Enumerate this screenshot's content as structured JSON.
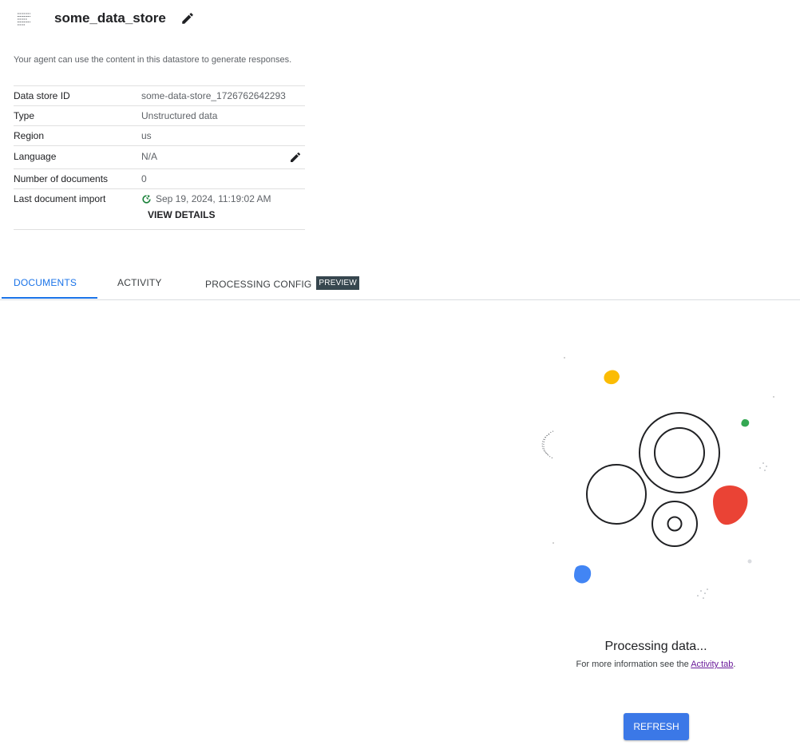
{
  "header": {
    "title": "some_data_store",
    "icon": "data-store-icon",
    "edit_icon": "edit-pencil-icon"
  },
  "description": "Your agent can use the content in this datastore to generate responses.",
  "info": {
    "rows": [
      {
        "label": "Data store ID",
        "value": "some-data-store_1726762642293"
      },
      {
        "label": "Type",
        "value": "Unstructured data"
      },
      {
        "label": "Region",
        "value": "us"
      },
      {
        "label": "Language",
        "value": "N/A"
      },
      {
        "label": "Number of documents",
        "value": "0"
      },
      {
        "label": "Last document import",
        "value": "Sep 19, 2024, 11:19:02 AM"
      }
    ],
    "view_details_label": "VIEW DETAILS",
    "status_icon": "in-progress-icon",
    "status_color": "#188038"
  },
  "tabs": {
    "items": [
      {
        "label": "DOCUMENTS"
      },
      {
        "label": "ACTIVITY"
      },
      {
        "label": "PROCESSING CONFIG"
      }
    ],
    "badge": "PREVIEW",
    "active_index": 0,
    "accent": "#1a73e8"
  },
  "empty_state": {
    "title": "Processing data...",
    "subtitle_prefix": "For more information see the ",
    "link_text": "Activity tab",
    "subtitle_suffix": ".",
    "button_label": "REFRESH"
  },
  "colors": {
    "yellow": "#fbbc04",
    "green": "#34a853",
    "red": "#ea4335",
    "blue": "#4285f4",
    "button": "#3b78e7"
  }
}
